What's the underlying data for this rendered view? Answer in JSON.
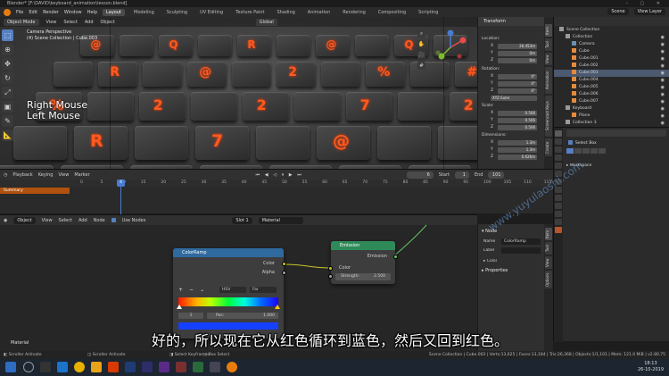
{
  "title_bar": {
    "title": "Blender* [F:\\DAVID\\keyboard_animation\\lesson.blend]",
    "window_controls": "– ▢ ✕"
  },
  "menu": {
    "items": [
      "File",
      "Edit",
      "Render",
      "Window",
      "Help"
    ],
    "workspaces": [
      "Layout",
      "Modeling",
      "Sculpting",
      "UV Editing",
      "Texture Paint",
      "Shading",
      "Animation",
      "Rendering",
      "Compositing",
      "Scripting"
    ],
    "active_workspace": "Layout",
    "scene": "Scene",
    "view_layer": "View Layer"
  },
  "viewport": {
    "mode": "Object Mode",
    "menus": [
      "View",
      "Select",
      "Add",
      "Object"
    ],
    "transform_orientation": "Global",
    "camera_info": [
      "Camera Perspective",
      "(4) Scene Collection | Cube.003"
    ],
    "overlay_text": [
      "Right Mouse",
      "Left Mouse"
    ],
    "key_glyphs": [
      "@",
      "Q",
      "R",
      "@",
      "Q",
      "R",
      "@",
      "2",
      "%",
      "#",
      "%",
      "2",
      "2",
      "7",
      "2",
      "R",
      "7",
      "@"
    ]
  },
  "n_panel": {
    "header": "Transform",
    "location_label": "Location:",
    "location": [
      "26.453m",
      "0m",
      "0m"
    ],
    "rotation_label": "Rotation:",
    "rotation": [
      "0°",
      "0°",
      "0°"
    ],
    "rotation_mode": "XYZ Euler",
    "scale_label": "Scale:",
    "scale": [
      "0.506",
      "0.506",
      "0.506"
    ],
    "dimensions_label": "Dimensions:",
    "dimensions": [
      "1.3m",
      "1.3m",
      "0.626m"
    ],
    "axis_labels": [
      "X",
      "Y",
      "Z"
    ],
    "tabs": [
      "Item",
      "Tool",
      "View",
      "Animation",
      "Screencast Keys",
      "Create"
    ]
  },
  "outliner": {
    "title": "Scene Collection",
    "rows": [
      {
        "name": "Collection",
        "indent": 1,
        "selected": false
      },
      {
        "name": "Camera",
        "indent": 2,
        "selected": false
      },
      {
        "name": "Cube",
        "indent": 2,
        "selected": false
      },
      {
        "name": "Cube.001",
        "indent": 2,
        "selected": false
      },
      {
        "name": "Cube.002",
        "indent": 2,
        "selected": false
      },
      {
        "name": "Cube.003",
        "indent": 2,
        "selected": true
      },
      {
        "name": "Cube.004",
        "indent": 2,
        "selected": false
      },
      {
        "name": "Cube.005",
        "indent": 2,
        "selected": false
      },
      {
        "name": "Cube.006",
        "indent": 2,
        "selected": false
      },
      {
        "name": "Cube.007",
        "indent": 2,
        "selected": false
      },
      {
        "name": "Keyboard",
        "indent": 1,
        "selected": false
      },
      {
        "name": "Plane",
        "indent": 2,
        "selected": false
      },
      {
        "name": "Collection 3",
        "indent": 1,
        "selected": false
      }
    ]
  },
  "properties": {
    "tool": "Select Box",
    "workspace_section": "Workspace"
  },
  "timeline": {
    "menus": [
      "Playback",
      "Keying",
      "View",
      "Marker"
    ],
    "current_frame": "6",
    "start_label": "Start",
    "start": "1",
    "end_label": "End",
    "end": "101",
    "summary_label": "Summary",
    "playhead_frame": "4",
    "ruler_ticks": [
      "0",
      "5",
      "10",
      "15",
      "20",
      "25",
      "30",
      "35",
      "40",
      "45",
      "50",
      "55",
      "60",
      "65",
      "70",
      "75",
      "80",
      "85",
      "90",
      "95",
      "100",
      "105",
      "110",
      "115"
    ]
  },
  "node_editor": {
    "type": "Object",
    "menus": [
      "View",
      "Select",
      "Add",
      "Node"
    ],
    "use_nodes_label": "Use Nodes",
    "slot": "Slot 1",
    "material": "Material",
    "bottom_label": "Material",
    "colorramp": {
      "title": "ColorRamp",
      "outputs": [
        "Color",
        "Alpha"
      ],
      "interpolation": [
        "HSV",
        "Far"
      ],
      "controls": [
        "+",
        "−",
        "⌄"
      ],
      "stop_index": "1",
      "pos_label": "Pos:",
      "pos_value": "1.000"
    },
    "emission": {
      "title": "Emission",
      "output": "Emission",
      "input_color": "Color",
      "strength_label": "Strength:",
      "strength_value": "2.500"
    },
    "colors": {
      "colorramp_header": "#2f6a9f",
      "emission_header": "#2f8a5a",
      "socket_color": "#c7c729",
      "socket_float": "#a1a1a1",
      "socket_shader": "#63c763"
    }
  },
  "node_panel": {
    "section": "Node",
    "name_label": "Name",
    "name_value": "ColorRamp",
    "label_label": "Label",
    "color_section": "Color",
    "properties_section": "Properties",
    "tabs": [
      "Item",
      "Tool",
      "View",
      "Options"
    ]
  },
  "subtitle": "好的，所以现在它从红色循环到蓝色，然后又回到红色。",
  "watermark": "www.yuyulaoshi.com",
  "status_bar": {
    "left": [
      "Scroller Activate",
      "Scroller Activate",
      "Select Keyframes",
      "Box Select"
    ],
    "right": "Scene Collection | Cube.003 | Verts:13,625 | Faces:13,184 | Tris:26,368 | Objects:1/1,101 | Mem: 121.0 MiB | v2.80.75"
  },
  "taskbar": {
    "time": "18:13",
    "date": "26-10-2019"
  }
}
